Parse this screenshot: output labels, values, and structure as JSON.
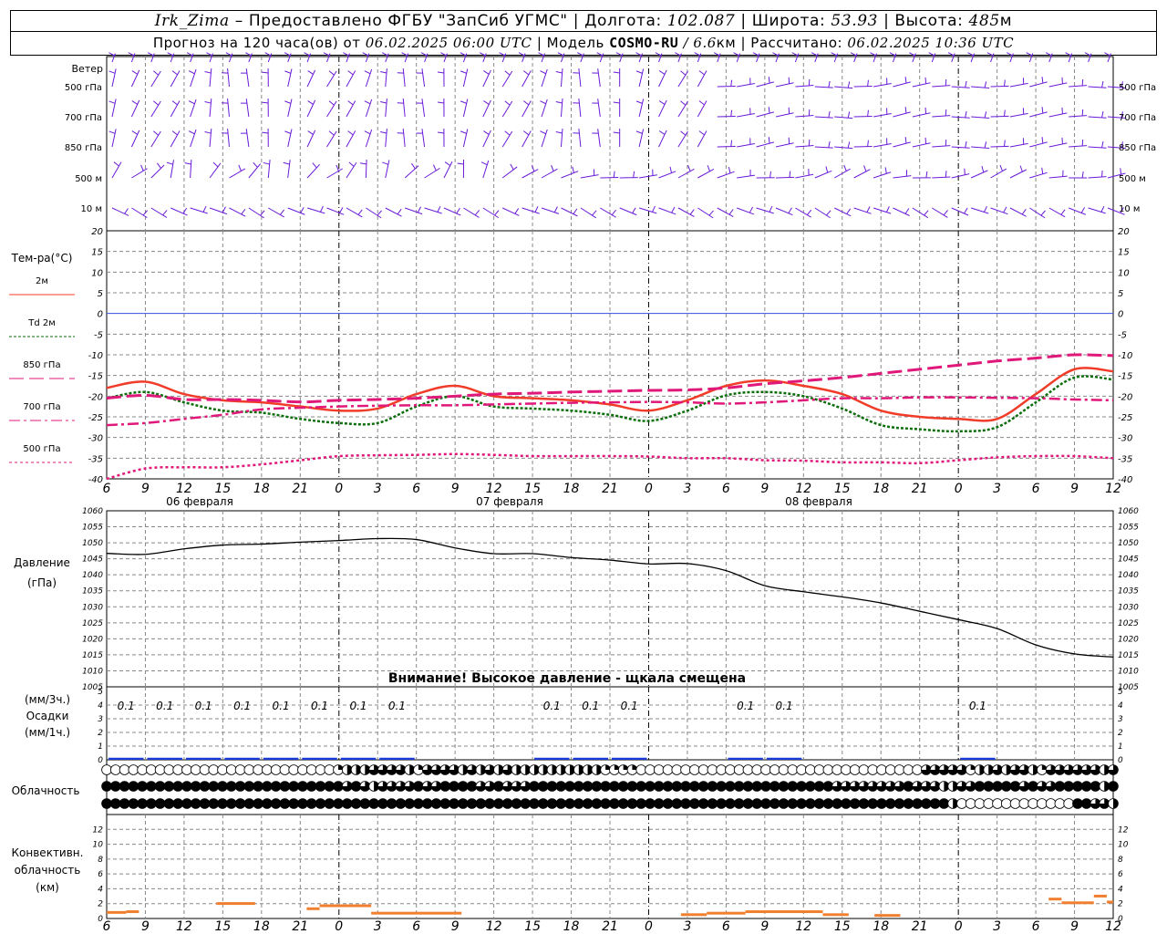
{
  "header": {
    "station": "Irk_Zima",
    "provider": "Предоставлено ФГБУ \"ЗапСиб УГМС\"",
    "lon_label": "Долгота:",
    "lon_value": "102.087",
    "lat_label": "Широта:",
    "lat_value": "53.93",
    "alt_label": "Высота:",
    "alt_value": "485",
    "alt_unit": "м",
    "forecast_text": "Прогноз на 120 часа(ов) от",
    "forecast_time": "06.02.2025 06:00 UTC",
    "model_label": "Модель",
    "model_name": "COSMO-RU",
    "model_res": "/ 6.6",
    "model_res_unit": "км",
    "calc_label": "Рассчитано:",
    "calc_time": "06.02.2025 10:36 UTC"
  },
  "labels": {
    "wind": "Ветер",
    "wind_levels": [
      "500 гПа",
      "700 гПа",
      "850 гПа",
      "500 м",
      "10 м"
    ],
    "temp": "Тем-ра(°C)",
    "temp_legend": [
      {
        "label": "2м",
        "color": "#f03c28",
        "dash": "none"
      },
      {
        "label": "Td 2м",
        "color": "#0a6e0a",
        "dash": "3,2"
      },
      {
        "label": "850 гПа",
        "color": "#e0187a",
        "dash": "16,6"
      },
      {
        "label": "700 гПа",
        "color": "#e0187a",
        "dash": "12,4,3,4"
      },
      {
        "label": "500 гПа",
        "color": "#e0187a",
        "dash": "3,3"
      }
    ],
    "pressure": [
      "Давление",
      "(гПа)"
    ],
    "pressure_warning": "Внимание! Высокое давление - щкала смещена",
    "precip": [
      "(мм/3ч.)",
      "Осадки",
      "(мм/1ч.)"
    ],
    "cloud": "Облачность",
    "convective": [
      "Конвективн.",
      "облачность",
      "(км)"
    ]
  },
  "time_axis": {
    "tick_labels": [
      "6",
      "9",
      "12",
      "15",
      "18",
      "21",
      "0",
      "3",
      "6",
      "9",
      "12",
      "15",
      "18",
      "21",
      "0",
      "3",
      "6",
      "9",
      "12",
      "15",
      "18",
      "21",
      "0",
      "3",
      "6",
      "9",
      "12"
    ],
    "dates": [
      "06 февраля",
      "07 февраля",
      "08 февраля"
    ]
  },
  "chart_data": [
    {
      "type": "line",
      "title": "Тем-ра(°C)",
      "ylim": [
        -40,
        20
      ],
      "yticks": [
        -40,
        -35,
        -30,
        -25,
        -20,
        -15,
        -10,
        -5,
        0,
        5,
        10,
        15,
        20
      ],
      "x_hours": [
        0,
        3,
        6,
        9,
        12,
        15,
        18,
        21,
        24,
        27,
        30,
        33,
        36,
        39,
        42,
        45,
        48,
        51,
        54,
        57,
        60,
        63,
        66,
        69,
        72,
        75,
        78
      ],
      "series": [
        {
          "name": "2м",
          "values": [
            -18,
            -16.5,
            -19.5,
            -21,
            -21.5,
            -22.5,
            -23.5,
            -23,
            -19.5,
            -17.5,
            -20,
            -20.5,
            -21,
            -22,
            -23.5,
            -21,
            -17.5,
            -16.2,
            -17.5,
            -19.5,
            -23.5,
            -25,
            -25.5,
            -25.5,
            -19.5,
            -13.5,
            -14
          ]
        },
        {
          "name": "Td 2м",
          "values": [
            -20.5,
            -19,
            -21.5,
            -23.5,
            -24,
            -25.5,
            -26.5,
            -26.5,
            -22.5,
            -20,
            -22.5,
            -23,
            -23.5,
            -24.5,
            -26,
            -23.5,
            -19.8,
            -19,
            -20,
            -23,
            -27,
            -28,
            -28.5,
            -27.5,
            -21.5,
            -15.5,
            -16
          ]
        },
        {
          "name": "850 гПа",
          "values": [
            -20.5,
            -19.8,
            -20.8,
            -20.8,
            -21,
            -21.4,
            -21,
            -20.8,
            -20.5,
            -20,
            -19.5,
            -19.3,
            -19,
            -18.8,
            -18.6,
            -18.5,
            -18,
            -17,
            -16.3,
            -15.5,
            -14.5,
            -13.5,
            -12.5,
            -11.5,
            -10.8,
            -10,
            -10.2
          ]
        },
        {
          "name": "700 гПа",
          "values": [
            -27,
            -26.5,
            -25.5,
            -24.5,
            -23.2,
            -22.8,
            -22.5,
            -22.3,
            -22.2,
            -22.2,
            -22,
            -21.8,
            -21.6,
            -21.5,
            -21.4,
            -21.5,
            -21.8,
            -21.5,
            -21,
            -20.5,
            -20.5,
            -20.3,
            -20.3,
            -20.4,
            -20.5,
            -20.8,
            -21
          ]
        },
        {
          "name": "500 гПа",
          "values": [
            -40,
            -37.5,
            -37.2,
            -37.2,
            -36.5,
            -35.5,
            -34.5,
            -34.3,
            -34.2,
            -34,
            -34.2,
            -34.5,
            -34.5,
            -34.5,
            -34.6,
            -35,
            -35,
            -35.5,
            -35.6,
            -36,
            -36,
            -36.2,
            -35.5,
            -34.8,
            -34.5,
            -34.5,
            -35
          ]
        }
      ]
    },
    {
      "type": "line",
      "title": "Давление (гПа)",
      "ylim": [
        1005,
        1060
      ],
      "yticks": [
        1005,
        1010,
        1015,
        1020,
        1025,
        1030,
        1035,
        1040,
        1045,
        1050,
        1055,
        1060
      ],
      "x_hours": [
        0,
        3,
        6,
        9,
        12,
        15,
        18,
        21,
        24,
        27,
        30,
        33,
        36,
        39,
        42,
        45,
        48,
        51,
        54,
        57,
        60,
        63,
        66,
        69,
        72,
        75,
        78
      ],
      "series": [
        {
          "name": "Давление",
          "values": [
            1046.7,
            1046.4,
            1048.1,
            1049.3,
            1049.6,
            1050.2,
            1050.7,
            1051.3,
            1051,
            1048.4,
            1046.6,
            1046.6,
            1045.4,
            1044.6,
            1043.4,
            1043.5,
            1041.3,
            1036.6,
            1034.7,
            1033.1,
            1031.2,
            1028.6,
            1026,
            1023.2,
            1018.1,
            1015.3,
            1014.3
          ]
        }
      ]
    },
    {
      "type": "bar",
      "title": "Осадки (мм/3ч.)",
      "ylim": [
        0,
        5
      ],
      "labels_at_hours": [
        0,
        3,
        6,
        9,
        12,
        15,
        18,
        21,
        33,
        36,
        39,
        48,
        51,
        66
      ],
      "values": [
        0.1,
        0.1,
        0.1,
        0.1,
        0.1,
        0.1,
        0.1,
        0.1,
        0.1,
        0.1,
        0.1,
        0.1,
        0.1,
        0.1
      ]
    },
    {
      "type": "bar",
      "title": "Конвективн. облачность (км)",
      "ylim": [
        0,
        14
      ],
      "yticks": [
        0,
        2,
        4,
        6,
        8,
        10,
        12
      ],
      "segments": [
        {
          "from": 0,
          "to": 1.5,
          "base": 0,
          "top": 1
        },
        {
          "from": 1.5,
          "to": 2.5,
          "base": 0,
          "top": 1.1
        },
        {
          "from": 8.5,
          "to": 11.5,
          "base": 0,
          "top": 2.2
        },
        {
          "from": 15.5,
          "to": 16.5,
          "base": 0,
          "top": 1.5
        },
        {
          "from": 16.5,
          "to": 20.5,
          "base": 0,
          "top": 1.9
        },
        {
          "from": 20.5,
          "to": 27.5,
          "base": 0,
          "top": 0.9
        },
        {
          "from": 44.5,
          "to": 46.5,
          "base": 0,
          "top": 0.7
        },
        {
          "from": 46.5,
          "to": 49.5,
          "base": 0,
          "top": 0.9
        },
        {
          "from": 49.5,
          "to": 55.5,
          "base": 0,
          "top": 1.1
        },
        {
          "from": 55.5,
          "to": 57.5,
          "base": 0,
          "top": 0.7
        },
        {
          "from": 59.5,
          "to": 61.5,
          "base": 0,
          "top": 0.6
        },
        {
          "from": 73,
          "to": 74,
          "base": 0,
          "top": 2.8
        },
        {
          "from": 74,
          "to": 76.5,
          "base": 0,
          "top": 2.3
        },
        {
          "from": 76.5,
          "to": 77.5,
          "base": 0,
          "top": 3.2
        },
        {
          "from": 77.5,
          "to": 78,
          "base": 0,
          "top": 2.4
        }
      ]
    }
  ],
  "cloud_rows": [
    "000000000000000000000000001222333321333323232322222222221111000000000000000000000000000000003333312232332133333323",
    "444444444444444444444444444343233334334444334333444444444444444444444444444444444433333333433322334444434334444424",
    "444444444444444444444444444444444444444444444444444444444444444444444444444444444444444444444442000000000000044332"
  ],
  "colors": {
    "wind": "#6a1ad8",
    "pressure": "#000000",
    "precip_bar": "#1a3ad8",
    "convective": "#f08030",
    "grid": "#888888",
    "zero_line": "#3050e0"
  }
}
